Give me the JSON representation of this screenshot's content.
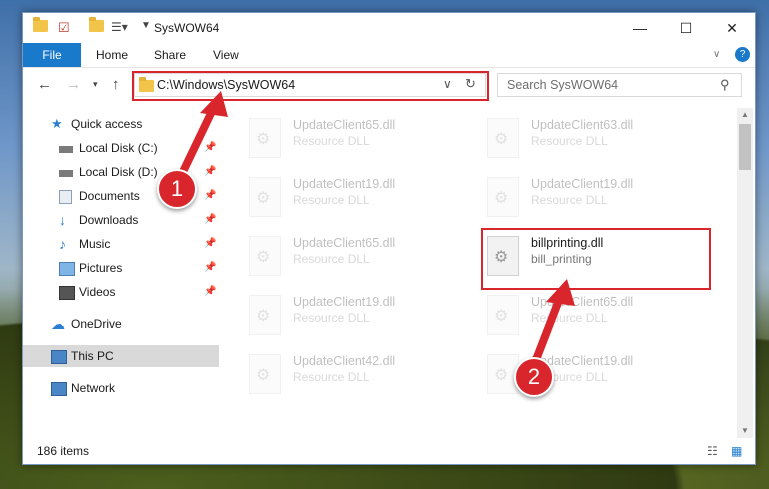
{
  "window": {
    "title": "SysWOW64"
  },
  "ribbon": {
    "tabs": [
      "File",
      "Home",
      "Share",
      "View"
    ]
  },
  "address": {
    "path": "C:\\Windows\\SysWOW64"
  },
  "search": {
    "placeholder": "Search SysWOW64"
  },
  "nav": {
    "quick_access": "Quick access",
    "items": [
      "Local Disk (C:)",
      "Local Disk (D:)",
      "Documents",
      "Downloads",
      "Music",
      "Pictures",
      "Videos"
    ],
    "onedrive": "OneDrive",
    "this_pc": "This PC",
    "network": "Network"
  },
  "files": [
    {
      "name": "UpdateClient65.dll",
      "type": "Resource DLL"
    },
    {
      "name": "UpdateClient63.dll",
      "type": "Resource DLL"
    },
    {
      "name": "UpdateClient19.dll",
      "type": "Resource DLL"
    },
    {
      "name": "UpdateClient19.dll",
      "type": "Resource DLL"
    },
    {
      "name": "UpdateClient65.dll",
      "type": "Resource DLL"
    },
    {
      "name": "billprinting.dll",
      "type": "bill_printing"
    },
    {
      "name": "UpdateClient19.dll",
      "type": "Resource DLL"
    },
    {
      "name": "UpdateClient65.dll",
      "type": "Resource DLL"
    },
    {
      "name": "UpdateClient42.dll",
      "type": "Resource DLL"
    },
    {
      "name": "UpdateClient19.dll",
      "type": "Resource DLL"
    }
  ],
  "status": {
    "item_count": "186 items"
  },
  "annotations": {
    "step1": "1",
    "step2": "2"
  },
  "colors": {
    "accent": "#1979ca",
    "annotation": "#d9262c"
  }
}
